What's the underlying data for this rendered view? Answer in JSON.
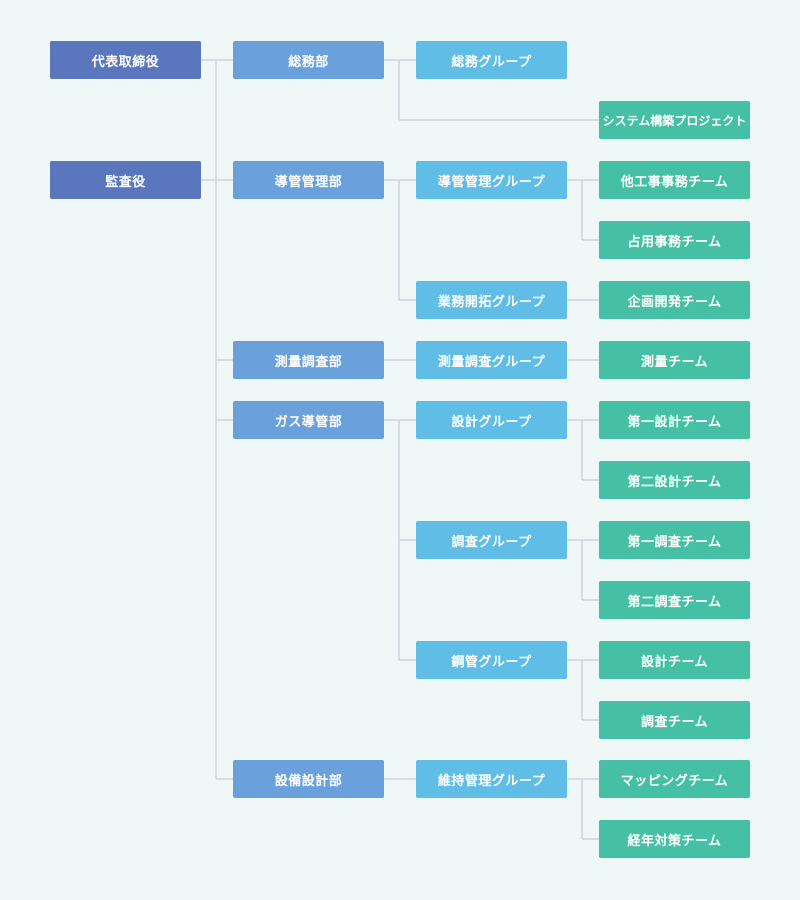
{
  "executives": {
    "president": "代表取締役",
    "auditor": "監査役"
  },
  "departments": {
    "general_affairs": "総務部",
    "conduit_management": "導管管理部",
    "survey": "測量調査部",
    "gas_conduit": "ガス導管部",
    "facility_design": "設備設計部"
  },
  "groups": {
    "general_affairs_group": "総務グループ",
    "conduit_management_group": "導管管理グループ",
    "business_development_group": "業務開拓グループ",
    "survey_group": "測量調査グループ",
    "design_group": "設計グループ",
    "investigation_group": "調査グループ",
    "steel_pipe_group": "鋼管グループ",
    "maintenance_group": "維持管理グループ"
  },
  "teams": {
    "system_project": "システム構築プロジェクト",
    "other_works_team": "他工事事務チーム",
    "occupancy_team": "占用事務チーム",
    "planning_team": "企画開発チーム",
    "survey_team": "測量チーム",
    "design_team_1": "第一設計チーム",
    "design_team_2": "第二設計チーム",
    "investigation_team_1": "第一調査チーム",
    "investigation_team_2": "第二調査チーム",
    "design_team": "設計チーム",
    "investigation_team": "調査チーム",
    "mapping_team": "マッピングチーム",
    "budget_team": "経年対策チーム"
  },
  "colors": {
    "background": "#eff8f6",
    "executive": "#5a77be",
    "department": "#6aa1dd",
    "group": "#5fbde6",
    "team": "#45c0a4",
    "connector": "#c9d6de"
  }
}
